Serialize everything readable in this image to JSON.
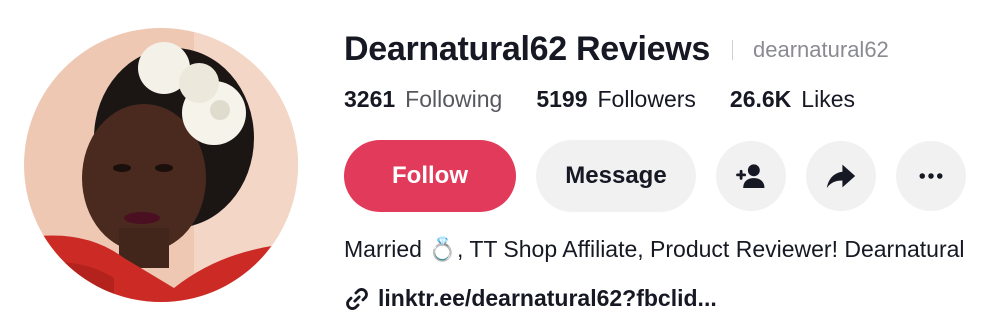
{
  "profile": {
    "display_name": "Dearnatural62 Reviews",
    "username": "dearnatural62",
    "avatar_icon": "profile-photo"
  },
  "stats": {
    "following_value": "3261",
    "following_label": "Following",
    "followers_value": "5199",
    "followers_label": "Followers",
    "likes_value": "26.6K",
    "likes_label": "Likes"
  },
  "actions": {
    "follow_label": "Follow",
    "message_label": "Message",
    "add_friend_icon": "person-plus-icon",
    "share_icon": "share-arrow-icon",
    "more_icon": "more-dots-icon"
  },
  "bio": {
    "text": "Married 💍, TT Shop Affiliate, Product Reviewer! Dearnatural"
  },
  "link": {
    "icon": "link-icon",
    "text": "linktr.ee/dearnatural62?fbclid..."
  },
  "colors": {
    "follow_button": "#e23a5a",
    "secondary_button": "#f1f1f2",
    "muted_text": "#8a8b91"
  }
}
